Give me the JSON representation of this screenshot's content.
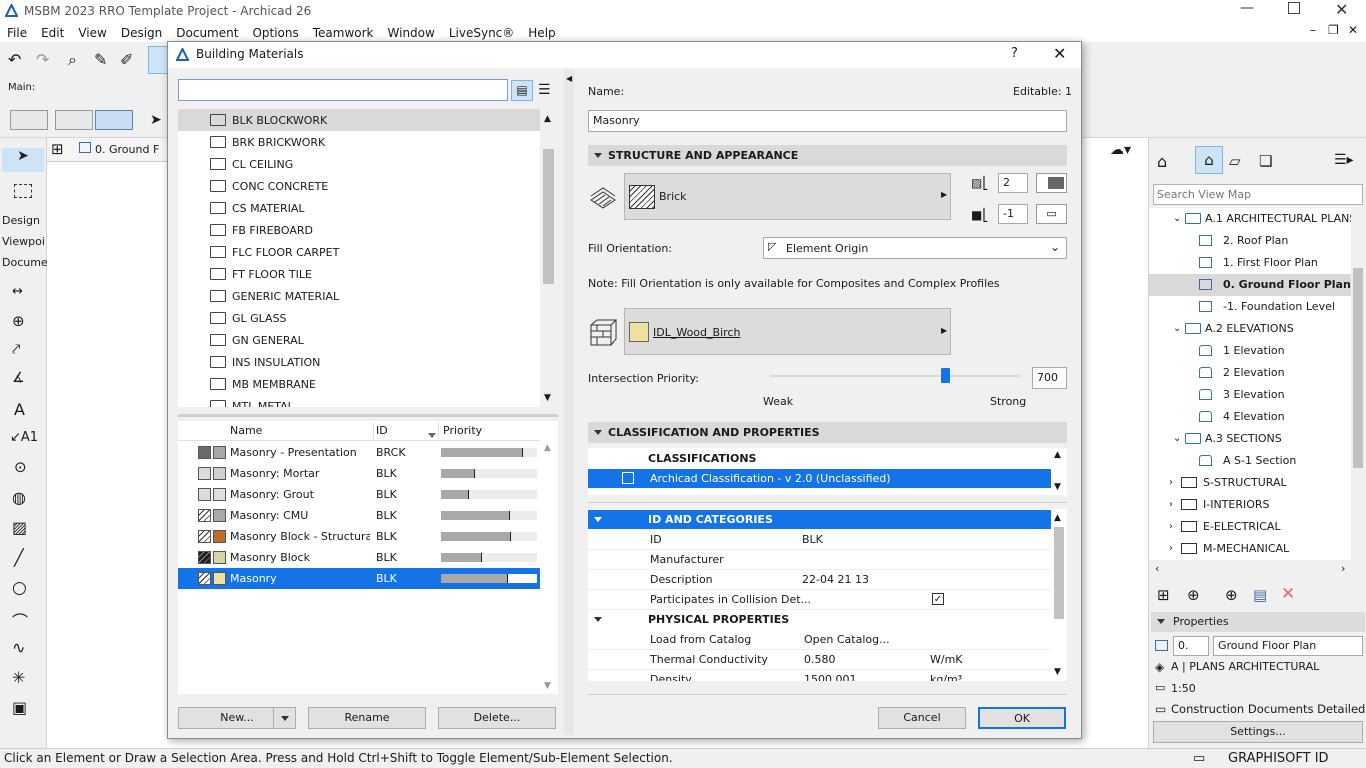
{
  "app": {
    "title": "MSBM 2023 RRO Template Project - Archicad 26"
  },
  "menu": [
    "File",
    "Edit",
    "View",
    "Design",
    "Document",
    "Options",
    "Teamwork",
    "Window",
    "LiveSync®",
    "Help"
  ],
  "toolbar": {
    "main_label": "Main:"
  },
  "tab": {
    "label": "0. Ground F"
  },
  "left_tabs": [
    "Design",
    "Viewpoi",
    "Docume"
  ],
  "status_text": "Click an Element or Draw a Selection Area. Press and Hold Ctrl+Shift to Toggle Element/Sub-Element Selection.",
  "graphisoft": "GRAPHISOFT ID",
  "dialog": {
    "title": "Building Materials",
    "help": "?",
    "search_value": "",
    "folders": [
      "BLK BLOCKWORK",
      "BRK BRICKWORK",
      "CL CEILING",
      "CONC CONCRETE",
      "CS MATERIAL",
      "FB FIREBOARD",
      "FLC FLOOR CARPET",
      "FT FLOOR TILE",
      "GENERIC MATERIAL",
      "GL GLASS",
      "GN GENERAL",
      "INS INSULATION",
      "MB MEMBRANE",
      "MTL METAL"
    ],
    "table_headers": {
      "name": "Name",
      "id": "ID",
      "priority": "Priority"
    },
    "materials": [
      {
        "name": "Masonry - Presentation",
        "id": "BRCK",
        "priority": 0.85,
        "fill": "#6b6b6b",
        "surf": "#a8a8a8"
      },
      {
        "name": "Masonry: Mortar",
        "id": "BLK",
        "priority": 0.35,
        "fill": "#dcdcdc",
        "surf": "#cfcfcf"
      },
      {
        "name": "Masonry: Grout",
        "id": "BLK",
        "priority": 0.29,
        "fill": "#dcdcdc",
        "surf": "#dedede"
      },
      {
        "name": "Masonry: CMU",
        "id": "BLK",
        "priority": 0.72,
        "fill": "#ffffff",
        "surf": "#a9a9a9"
      },
      {
        "name": "Masonry Block - Structural...",
        "id": "BLK",
        "priority": 0.73,
        "fill": "#ffffff",
        "surf": "#c46a2a"
      },
      {
        "name": "Masonry Block",
        "id": "BLK",
        "priority": 0.43,
        "fill": "#1c1c1c",
        "surf": "#d8d2a6"
      },
      {
        "name": "Masonry",
        "id": "BLK",
        "priority": 0.7,
        "fill": "#ffffff",
        "surf": "#f1e1a0"
      }
    ],
    "buttons": {
      "new": "New...",
      "rename": "Rename",
      "delete": "Delete...",
      "cancel": "Cancel",
      "ok": "OK"
    },
    "name_label": "Name:",
    "editable": "Editable: 1",
    "name_value": "Masonry",
    "structure_title": "STRUCTURE AND APPEARANCE",
    "cut_fill": "Brick",
    "pen1": "2",
    "pen2": "-1",
    "fill_orientation_label": "Fill Orientation:",
    "fill_orientation_value": "Element Origin",
    "note": "Note: Fill Orientation is only available for Composites and Complex Profiles",
    "surface": "IDL_Wood_Birch",
    "intersection_label": "Intersection Priority:",
    "intersection_value": "700",
    "intersection_level": 0.7,
    "weak": "Weak",
    "strong": "Strong",
    "classification_title": "CLASSIFICATION AND PROPERTIES",
    "classifications_header": "CLASSIFICATIONS",
    "classification_item": "Archicad Classification - v 2.0 (Unclassified)",
    "id_categories": "ID AND CATEGORIES",
    "props": [
      {
        "label": "ID",
        "value": "BLK",
        "unit": ""
      },
      {
        "label": "Manufacturer",
        "value": "",
        "unit": ""
      },
      {
        "label": "Description",
        "value": "22-04 21 13",
        "unit": ""
      },
      {
        "label": "Participates in Collision Det...",
        "value": "",
        "unit": ""
      }
    ],
    "physical_title": "PHYSICAL PROPERTIES",
    "physical": [
      {
        "label": "Load from Catalog",
        "value": "Open Catalog...",
        "unit": ""
      },
      {
        "label": "Thermal Conductivity",
        "value": "0.580",
        "unit": "W/mK"
      },
      {
        "label": "Density",
        "value": "1500.001",
        "unit": "kg/m³"
      }
    ]
  },
  "nav": {
    "search_placeholder": "Search View Map",
    "items": [
      {
        "label": "A.1 ARCHITECTURAL PLANS",
        "indent": 1,
        "type": "group"
      },
      {
        "label": "2. Roof Plan",
        "indent": 2,
        "type": "plan"
      },
      {
        "label": "1. First Floor Plan",
        "indent": 2,
        "type": "plan"
      },
      {
        "label": "0. Ground Floor Plan",
        "indent": 2,
        "type": "plan",
        "selected": true
      },
      {
        "label": "-1. Foundation Level",
        "indent": 2,
        "type": "plan"
      },
      {
        "label": "A.2 ELEVATIONS",
        "indent": 1,
        "type": "group"
      },
      {
        "label": "1 Elevation",
        "indent": 2,
        "type": "elev"
      },
      {
        "label": "2 Elevation",
        "indent": 2,
        "type": "elev"
      },
      {
        "label": "3 Elevation",
        "indent": 2,
        "type": "elev"
      },
      {
        "label": "4 Elevation",
        "indent": 2,
        "type": "elev"
      },
      {
        "label": "A.3 SECTIONS",
        "indent": 1,
        "type": "group"
      },
      {
        "label": "A S-1 Section",
        "indent": 2,
        "type": "elev"
      },
      {
        "label": "S-STRUCTURAL",
        "indent": 0,
        "type": "folder"
      },
      {
        "label": "I-INTERIORS",
        "indent": 0,
        "type": "folder"
      },
      {
        "label": "E-ELECTRICAL",
        "indent": 0,
        "type": "folder"
      },
      {
        "label": "M-MECHANICAL",
        "indent": 0,
        "type": "folder"
      }
    ],
    "properties_title": "Properties",
    "prop_id": "0.",
    "prop_name": "Ground Floor Plan",
    "layer_combo": "A | PLANS ARCHITECTURAL",
    "scale": "1:50",
    "model_view": "Construction Documents Detailed",
    "settings": "Settings..."
  }
}
